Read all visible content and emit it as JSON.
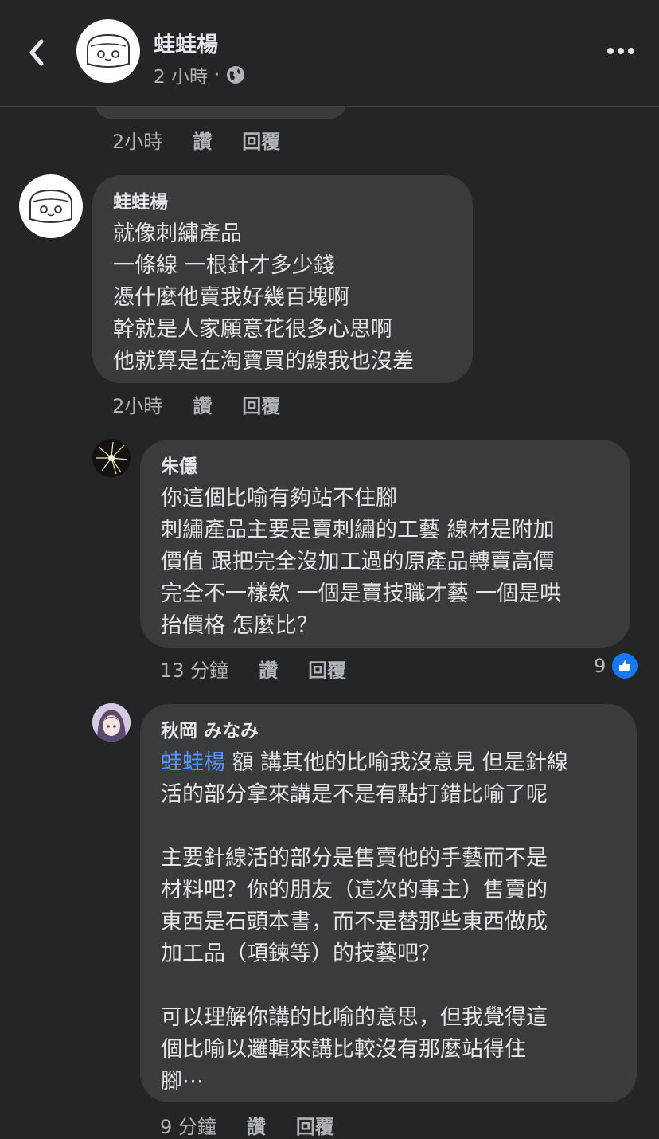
{
  "header": {
    "poster_name": "蛙蛙楊",
    "time": "2 小時",
    "separator": "·"
  },
  "comments": [
    {
      "time": "2小時",
      "like_label": "讚",
      "reply_label": "回覆"
    },
    {
      "author": "蛙蛙楊",
      "lines": [
        "就像刺繡產品",
        "一條線 一根針才多少錢",
        "憑什麼他賣我好幾百塊啊",
        "幹就是人家願意花很多心思啊",
        "他就算是在淘寶買的線我也沒差"
      ],
      "time": "2小時",
      "like_label": "讚",
      "reply_label": "回覆"
    },
    {
      "author": "朱㒚",
      "lines": [
        "你這個比喻有夠站不住腳",
        "刺繡產品主要是賣刺繡的工藝 線材是附加",
        "價值 跟把完全沒加工過的原產品轉賣高價",
        "完全不一樣欸 一個是賣技職才藝 一個是哄",
        "抬價格 怎麼比？"
      ],
      "time": "13 分鐘",
      "like_label": "讚",
      "reply_label": "回覆",
      "reaction_count": "9"
    },
    {
      "author": "秋岡 みなみ",
      "mention": "蛙蛙楊",
      "first_line_rest": " 額 講其他的比喻我沒意見 但是針線",
      "lines_p1": [
        "活的部分拿來講是不是有點打錯比喻了呢"
      ],
      "lines_p2": [
        "主要針線活的部分是售賣他的手藝而不是",
        "材料吧？你的朋友（這次的事主）售賣的",
        "東西是石頭本書，而不是替那些東西做成",
        "加工品（項鍊等）的技藝吧？"
      ],
      "lines_p3": [
        "可以理解你講的比喻的意思，但我覺得這",
        "個比喻以邏輯來講比較沒有那麼站得住",
        "腳⋯"
      ],
      "time": "9 分鐘",
      "like_label": "讚",
      "reply_label": "回覆"
    }
  ],
  "icons": [
    "back-chevron-icon",
    "globe-icon",
    "more-options-icon",
    "like-thumb-icon"
  ],
  "colors": {
    "background": "#242526",
    "bubble": "#3a3b3c",
    "mention": "#5a93ff",
    "like": "#1877f2"
  }
}
